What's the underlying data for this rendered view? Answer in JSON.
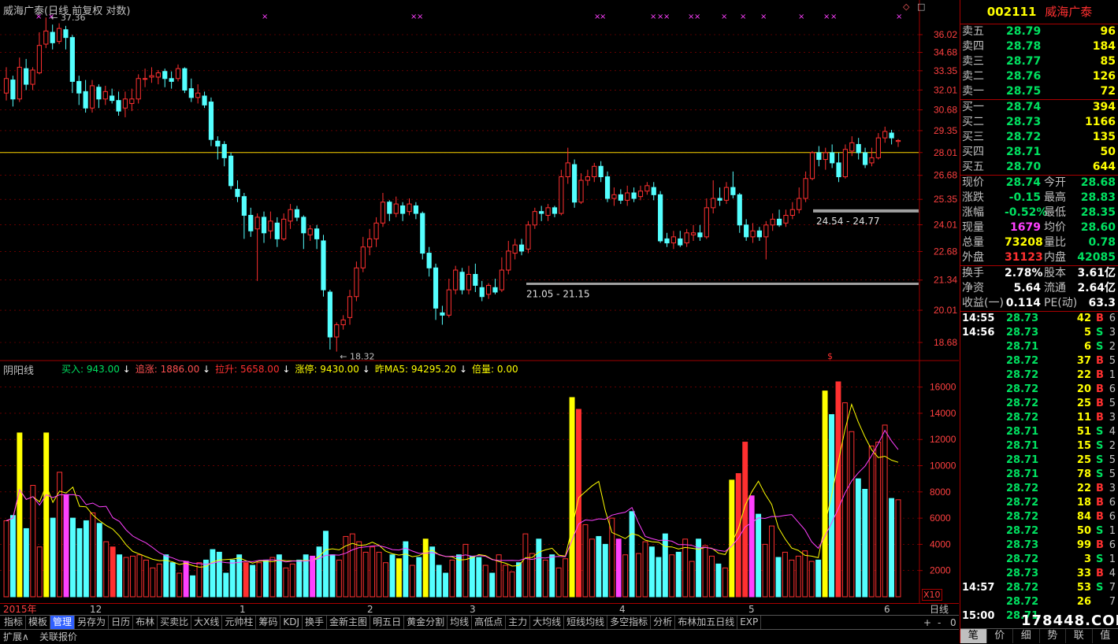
{
  "title": "威海广泰(日线 前复权 对数)",
  "corner_icons": [
    "◇",
    "□"
  ],
  "price_axis": [
    "36.02",
    "34.68",
    "33.35",
    "32.01",
    "30.68",
    "29.35",
    "28.01",
    "26.68",
    "25.35",
    "24.01",
    "22.68",
    "21.34",
    "20.01",
    "18.68"
  ],
  "volume_axis": [
    "16000",
    "14000",
    "12000",
    "10000",
    "8000",
    "6000",
    "4000",
    "2000"
  ],
  "volume_unit": "X10",
  "annotations": {
    "high": "37.36",
    "low": "18.32",
    "range1": "21.05 - 21.15",
    "range2": "24.54 - 24.77",
    "signal": "$"
  },
  "indicator": {
    "name": "阴阳线",
    "values": [
      {
        "label": "买入: 943.00",
        "arrow": "↓",
        "color": "#00e060"
      },
      {
        "label": "追涨: 1886.00",
        "arrow": "↓",
        "color": "#ff5050"
      },
      {
        "label": "拉升: 5658.00",
        "arrow": "↓",
        "color": "#ff3030"
      },
      {
        "label": "涨停: 9430.00",
        "arrow": "↓",
        "color": "#ffff00"
      },
      {
        "label": "昨MA5: 94295.20",
        "arrow": "↓",
        "color": "#ffff00"
      },
      {
        "label": "倍量: 0.00",
        "arrow": "",
        "color": "#ffff00"
      }
    ]
  },
  "date_axis": [
    {
      "label": "2015年",
      "x": 4,
      "color": "#ff4040"
    },
    {
      "label": "12",
      "x": 114,
      "color": "#c0c0c0"
    },
    {
      "label": "1",
      "x": 304,
      "color": "#c0c0c0"
    },
    {
      "label": "2",
      "x": 466,
      "color": "#c0c0c0"
    },
    {
      "label": "3",
      "x": 596,
      "color": "#c0c0c0"
    },
    {
      "label": "4",
      "x": 786,
      "color": "#c0c0c0"
    },
    {
      "label": "5",
      "x": 950,
      "color": "#c0c0c0"
    },
    {
      "label": "6",
      "x": 1122,
      "color": "#c0c0c0"
    }
  ],
  "day_label": "日线",
  "tabs": [
    "指标",
    "模板",
    "管理",
    "另存为",
    "日历",
    "布林",
    "买卖比",
    "大X线",
    "元帅柱",
    "筹码",
    "KDJ",
    "换手",
    "金新主图",
    "明五日",
    "黄金分割",
    "均线",
    "高低点",
    "主力",
    "大均线",
    "短线均线",
    "多空指标",
    "分析",
    "布林加五日线",
    "EXP"
  ],
  "active_tab": "管理",
  "status": {
    "left": "扩展∧",
    "mid": "关联报价"
  },
  "scroll_controls": [
    "+",
    "-",
    "0"
  ],
  "quote": {
    "code": "002111",
    "name": "威海广泰",
    "sells": [
      {
        "label": "卖五",
        "price": "28.79",
        "vol": "96"
      },
      {
        "label": "卖四",
        "price": "28.78",
        "vol": "184"
      },
      {
        "label": "卖三",
        "price": "28.77",
        "vol": "85"
      },
      {
        "label": "卖二",
        "price": "28.76",
        "vol": "126"
      },
      {
        "label": "卖一",
        "price": "28.75",
        "vol": "72"
      }
    ],
    "buys": [
      {
        "label": "买一",
        "price": "28.74",
        "vol": "394"
      },
      {
        "label": "买二",
        "price": "28.73",
        "vol": "1166"
      },
      {
        "label": "买三",
        "price": "28.72",
        "vol": "135"
      },
      {
        "label": "买四",
        "price": "28.71",
        "vol": "50"
      },
      {
        "label": "买五",
        "price": "28.70",
        "vol": "644"
      }
    ],
    "stats1": [
      {
        "a": "现价",
        "b": "28.74",
        "bc": "#00e060",
        "c": "今开",
        "d": "28.68",
        "dc": "#00e060"
      },
      {
        "a": "涨跌",
        "b": "-0.15",
        "bc": "#00e060",
        "c": "最高",
        "d": "28.83",
        "dc": "#00e060"
      },
      {
        "a": "涨幅",
        "b": "-0.52%",
        "bc": "#00e060",
        "c": "最低",
        "d": "28.35",
        "dc": "#00e060"
      },
      {
        "a": "现量",
        "b": "1679",
        "bc": "#ff40ff",
        "c": "均价",
        "d": "28.60",
        "dc": "#00e060"
      },
      {
        "a": "总量",
        "b": "73208",
        "bc": "#ffff00",
        "c": "量比",
        "d": "0.78",
        "dc": "#00e060"
      },
      {
        "a": "外盘",
        "b": "31123",
        "bc": "#ff3030",
        "c": "内盘",
        "d": "42085",
        "dc": "#00e060"
      }
    ],
    "stats2": [
      {
        "a": "换手",
        "b": "2.78%",
        "c": "股本",
        "d": "3.61亿"
      },
      {
        "a": "净资",
        "b": "5.64",
        "c": "流通",
        "d": "2.64亿"
      },
      {
        "a": "收益(一)",
        "b": "0.114",
        "c": "PE(动)",
        "d": "63.3"
      }
    ],
    "ticks": [
      {
        "t": "14:55",
        "p": "28.73",
        "v": "42",
        "s": "B",
        "n": "6"
      },
      {
        "t": "14:56",
        "p": "28.73",
        "v": "5",
        "s": "S",
        "n": "3"
      },
      {
        "t": "",
        "p": "28.71",
        "v": "6",
        "s": "S",
        "n": "2"
      },
      {
        "t": "",
        "p": "28.72",
        "v": "37",
        "s": "B",
        "n": "5"
      },
      {
        "t": "",
        "p": "28.72",
        "v": "22",
        "s": "B",
        "n": "1"
      },
      {
        "t": "",
        "p": "28.72",
        "v": "20",
        "s": "B",
        "n": "6"
      },
      {
        "t": "",
        "p": "28.72",
        "v": "25",
        "s": "B",
        "n": "5"
      },
      {
        "t": "",
        "p": "28.72",
        "v": "11",
        "s": "B",
        "n": "3"
      },
      {
        "t": "",
        "p": "28.71",
        "v": "51",
        "s": "S",
        "n": "4"
      },
      {
        "t": "",
        "p": "28.71",
        "v": "15",
        "s": "S",
        "n": "2"
      },
      {
        "t": "",
        "p": "28.71",
        "v": "25",
        "s": "S",
        "n": "5"
      },
      {
        "t": "",
        "p": "28.71",
        "v": "78",
        "s": "S",
        "n": "5"
      },
      {
        "t": "",
        "p": "28.72",
        "v": "22",
        "s": "B",
        "n": "3"
      },
      {
        "t": "",
        "p": "28.72",
        "v": "18",
        "s": "B",
        "n": "6"
      },
      {
        "t": "",
        "p": "28.72",
        "v": "84",
        "s": "B",
        "n": "6"
      },
      {
        "t": "",
        "p": "28.72",
        "v": "50",
        "s": "S",
        "n": "1"
      },
      {
        "t": "",
        "p": "28.73",
        "v": "99",
        "s": "B",
        "n": "6"
      },
      {
        "t": "",
        "p": "28.72",
        "v": "3",
        "s": "S",
        "n": "1"
      },
      {
        "t": "",
        "p": "28.73",
        "v": "33",
        "s": "B",
        "n": "4"
      },
      {
        "t": "14:57",
        "p": "28.72",
        "v": "53",
        "s": "S",
        "n": "7"
      },
      {
        "t": "",
        "p": "28.72",
        "v": "26",
        "s": "",
        "n": "7"
      },
      {
        "t": "15:00",
        "p": "28.71",
        "v": "",
        "s": "",
        "n": ""
      }
    ],
    "bottom_tabs": [
      "笔",
      "价",
      "细",
      "势",
      "联",
      "值"
    ]
  },
  "watermark": "178448.COM",
  "colors": {
    "up": "#ff3030",
    "down": "#54ffff",
    "ma_fast": "#ffff00",
    "ma_slow": "#ff40ff",
    "grid": "#a00000",
    "hline": "#ffd700"
  },
  "chart_data": {
    "type": "candlestick",
    "scale": "log",
    "ylim": [
      18.68,
      36.02
    ],
    "reference_price": 28.01,
    "high_mark": 37.36,
    "low_mark": 18.32,
    "candles": [
      [
        31.8,
        32.8,
        33.6,
        31.3
      ],
      [
        32.7,
        31.4,
        33.0,
        30.9
      ],
      [
        31.4,
        33.6,
        34.3,
        31.2
      ],
      [
        33.5,
        32.4,
        34.2,
        32.0
      ],
      [
        32.4,
        33.4,
        33.6,
        32.0
      ],
      [
        33.2,
        35.2,
        36.2,
        33.1
      ],
      [
        35.3,
        36.3,
        37.36,
        35.0
      ],
      [
        36.2,
        35.4,
        36.8,
        34.9
      ],
      [
        35.5,
        36.5,
        36.9,
        35.3
      ],
      [
        36.4,
        35.8,
        36.7,
        34.9
      ],
      [
        35.8,
        32.6,
        36.0,
        31.8
      ],
      [
        32.6,
        31.8,
        33.0,
        31.0
      ],
      [
        31.9,
        30.8,
        32.7,
        30.5
      ],
      [
        30.8,
        32.3,
        32.7,
        30.5
      ],
      [
        32.2,
        31.4,
        32.4,
        30.8
      ],
      [
        31.4,
        31.9,
        32.3,
        31.0
      ],
      [
        31.6,
        31.3,
        32.1,
        31.1
      ],
      [
        31.3,
        30.6,
        31.9,
        30.3
      ],
      [
        30.8,
        31.4,
        31.9,
        30.2
      ],
      [
        31.1,
        31.4,
        32.1,
        30.6
      ],
      [
        31.4,
        32.8,
        33.1,
        31.1
      ],
      [
        32.8,
        32.8,
        33.5,
        32.2
      ],
      [
        32.9,
        33.0,
        33.6,
        32.5
      ],
      [
        32.9,
        33.2,
        33.4,
        32.4
      ],
      [
        33.3,
        32.8,
        33.5,
        32.2
      ],
      [
        32.8,
        32.6,
        33.3,
        32.1
      ],
      [
        32.8,
        33.5,
        33.8,
        32.6
      ],
      [
        33.5,
        32.0,
        33.6,
        31.8
      ],
      [
        32.1,
        31.5,
        32.8,
        31.2
      ],
      [
        31.5,
        31.8,
        32.4,
        31.1
      ],
      [
        31.6,
        31.0,
        31.9,
        30.8
      ],
      [
        31.2,
        28.8,
        31.5,
        28.4
      ],
      [
        28.7,
        28.4,
        29.0,
        27.6
      ],
      [
        28.5,
        27.7,
        28.7,
        27.2
      ],
      [
        27.8,
        26.1,
        28.0,
        25.9
      ],
      [
        25.9,
        25.5,
        26.4,
        25.2
      ],
      [
        25.5,
        24.5,
        25.7,
        23.3
      ],
      [
        24.5,
        23.7,
        24.9,
        23.4
      ],
      [
        23.8,
        24.4,
        24.6,
        21.3
      ],
      [
        24.4,
        23.6,
        24.7,
        23.1
      ],
      [
        23.7,
        24.2,
        24.7,
        23.3
      ],
      [
        24.1,
        23.3,
        24.4,
        22.9
      ],
      [
        23.3,
        24.3,
        24.6,
        23.2
      ],
      [
        24.2,
        24.8,
        25.1,
        23.8
      ],
      [
        24.8,
        24.4,
        25.0,
        24.2
      ],
      [
        24.4,
        23.6,
        24.5,
        22.8
      ],
      [
        23.5,
        23.8,
        24.0,
        23.2
      ],
      [
        23.8,
        23.3,
        24.0,
        22.8
      ],
      [
        23.2,
        20.9,
        23.5,
        20.6
      ],
      [
        20.8,
        18.9,
        20.9,
        18.4
      ],
      [
        18.9,
        19.4,
        19.5,
        18.32
      ],
      [
        19.4,
        19.6,
        19.8,
        19.2
      ],
      [
        19.7,
        20.6,
        20.9,
        19.4
      ],
      [
        20.6,
        21.9,
        22.2,
        20.4
      ],
      [
        21.9,
        22.9,
        23.4,
        21.7
      ],
      [
        22.9,
        23.3,
        23.8,
        22.5
      ],
      [
        23.3,
        24.1,
        24.4,
        22.9
      ],
      [
        24.1,
        25.2,
        25.7,
        23.9
      ],
      [
        25.2,
        24.6,
        25.3,
        24.2
      ],
      [
        24.6,
        25.1,
        25.5,
        24.4
      ],
      [
        25.0,
        24.6,
        25.2,
        24.2
      ],
      [
        24.7,
        25.1,
        25.4,
        24.5
      ],
      [
        25.0,
        24.6,
        25.2,
        24.3
      ],
      [
        24.6,
        22.6,
        24.7,
        22.3
      ],
      [
        22.6,
        21.9,
        22.9,
        21.5
      ],
      [
        21.9,
        20.1,
        22.1,
        19.6
      ],
      [
        19.9,
        19.8,
        20.2,
        19.4
      ],
      [
        19.8,
        20.9,
        21.4,
        19.7
      ],
      [
        20.9,
        21.8,
        22.0,
        20.7
      ],
      [
        21.7,
        20.9,
        21.9,
        20.7
      ],
      [
        20.9,
        21.6,
        22.0,
        20.7
      ],
      [
        21.6,
        21.1,
        22.1,
        20.8
      ],
      [
        21.0,
        20.6,
        21.3,
        20.4
      ],
      [
        20.7,
        21.1,
        21.2,
        20.5
      ],
      [
        21.0,
        20.8,
        21.4,
        20.7
      ],
      [
        20.9,
        21.8,
        22.4,
        20.8
      ],
      [
        21.8,
        22.7,
        23.2,
        21.6
      ],
      [
        22.6,
        23.0,
        23.3,
        22.3
      ],
      [
        23.0,
        22.7,
        23.3,
        22.5
      ],
      [
        22.8,
        24.0,
        24.2,
        22.6
      ],
      [
        24.0,
        24.7,
        24.9,
        23.8
      ],
      [
        24.7,
        24.6,
        25.0,
        24.2
      ],
      [
        24.5,
        24.9,
        25.1,
        24.2
      ],
      [
        24.9,
        24.6,
        25.0,
        24.4
      ],
      [
        24.6,
        26.6,
        27.0,
        24.5
      ],
      [
        26.6,
        27.4,
        28.3,
        26.2
      ],
      [
        27.3,
        25.2,
        27.6,
        24.9
      ],
      [
        25.2,
        26.4,
        26.8,
        25.1
      ],
      [
        26.4,
        26.6,
        27.0,
        26.1
      ],
      [
        26.6,
        27.2,
        27.4,
        26.3
      ],
      [
        27.2,
        26.6,
        27.5,
        26.3
      ],
      [
        26.6,
        25.4,
        26.9,
        25.2
      ],
      [
        25.4,
        25.6,
        26.0,
        25.0
      ],
      [
        25.6,
        25.3,
        25.9,
        25.1
      ],
      [
        25.3,
        25.7,
        26.1,
        25.0
      ],
      [
        25.7,
        25.4,
        26.0,
        25.2
      ],
      [
        25.5,
        25.8,
        26.1,
        25.3
      ],
      [
        25.8,
        26.1,
        26.3,
        25.6
      ],
      [
        26.0,
        25.6,
        26.3,
        25.3
      ],
      [
        25.6,
        23.2,
        25.8,
        23.1
      ],
      [
        23.3,
        23.1,
        23.6,
        22.9
      ],
      [
        23.1,
        23.4,
        23.7,
        22.8
      ],
      [
        23.3,
        23.0,
        23.7,
        22.9
      ],
      [
        23.1,
        23.6,
        23.8,
        22.9
      ],
      [
        23.5,
        23.6,
        24.0,
        23.2
      ],
      [
        23.6,
        23.4,
        24.0,
        23.2
      ],
      [
        23.4,
        24.9,
        25.4,
        23.3
      ],
      [
        24.9,
        25.4,
        26.4,
        24.6
      ],
      [
        25.4,
        25.3,
        26.0,
        25.0
      ],
      [
        25.3,
        26.0,
        26.3,
        25.1
      ],
      [
        26.0,
        25.6,
        26.9,
        25.4
      ],
      [
        25.6,
        24.0,
        25.7,
        23.6
      ],
      [
        24.0,
        23.4,
        24.3,
        23.2
      ],
      [
        23.4,
        23.7,
        24.1,
        23.1
      ],
      [
        23.7,
        23.4,
        23.9,
        23.2
      ],
      [
        23.4,
        24.0,
        24.2,
        22.3
      ],
      [
        24.0,
        24.3,
        24.6,
        23.7
      ],
      [
        24.3,
        24.0,
        24.8,
        23.9
      ],
      [
        24.1,
        24.5,
        24.8,
        23.9
      ],
      [
        24.5,
        24.8,
        25.2,
        24.3
      ],
      [
        24.8,
        25.4,
        26.0,
        24.6
      ],
      [
        25.4,
        26.5,
        26.9,
        25.2
      ],
      [
        26.5,
        28.0,
        28.1,
        26.4
      ],
      [
        28.0,
        27.6,
        28.4,
        27.2
      ],
      [
        27.6,
        28.0,
        28.3,
        27.0
      ],
      [
        28.0,
        27.4,
        28.5,
        27.1
      ],
      [
        27.4,
        26.6,
        28.0,
        26.3
      ],
      [
        26.6,
        28.2,
        28.5,
        26.5
      ],
      [
        28.1,
        28.6,
        29.0,
        27.8
      ],
      [
        28.5,
        28.0,
        28.9,
        27.6
      ],
      [
        28.0,
        27.3,
        28.3,
        27.1
      ],
      [
        27.4,
        27.7,
        28.3,
        27.2
      ],
      [
        27.7,
        28.9,
        29.2,
        27.6
      ],
      [
        28.9,
        29.3,
        29.6,
        28.6
      ],
      [
        29.2,
        28.9,
        29.4,
        28.5
      ],
      [
        28.68,
        28.74,
        28.83,
        28.35
      ]
    ],
    "volumes": [
      5800,
      6200,
      12500,
      5200,
      8500,
      3800,
      12500,
      6000,
      9500,
      7800,
      6000,
      5200,
      5800,
      6400,
      5600,
      4200,
      3800,
      3200,
      3000,
      3100,
      3200,
      2800,
      2200,
      2500,
      3200,
      2600,
      1800,
      2700,
      1600,
      2600,
      2800,
      3600,
      3400,
      1800,
      2800,
      3200,
      2600,
      2400,
      2600,
      2800,
      3000,
      3200,
      2200,
      2500,
      2800,
      3200,
      3100,
      3800,
      5000,
      3200,
      2800,
      4600,
      4800,
      4200,
      3400,
      3800,
      3400,
      2600,
      3200,
      2900,
      4200,
      2400,
      3000,
      4400,
      3800,
      2400,
      1800,
      2800,
      3200,
      4000,
      3100,
      3000,
      2400,
      1800,
      3200,
      2400,
      1900,
      2600,
      4800,
      3300,
      4400,
      2800,
      3200,
      2200,
      2900,
      15200,
      14300,
      5500,
      4400,
      4600,
      4000,
      6000,
      4400,
      3200,
      6500,
      3300,
      4200,
      3800,
      3000,
      4800,
      3200,
      3400,
      4400,
      2700,
      4400,
      3900,
      3100,
      2500,
      2200,
      8900,
      9400,
      11800,
      7700,
      6300,
      4000,
      5400,
      3000,
      3400,
      2800,
      3100,
      3500,
      2700,
      2800,
      15700,
      13900,
      16400,
      14800,
      12600,
      9000,
      8200,
      11500,
      11800,
      13100,
      7500,
      7400
    ],
    "volume_colors": "up=red hollow/solid, down=cyan, magenta=special, yellow=limit"
  }
}
